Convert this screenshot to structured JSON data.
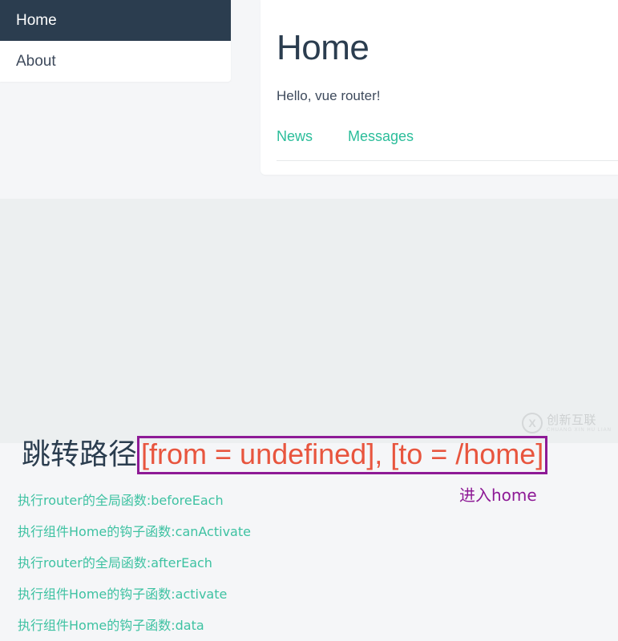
{
  "sidebar": {
    "items": [
      {
        "label": "Home",
        "active": true
      },
      {
        "label": "About",
        "active": false
      }
    ]
  },
  "content": {
    "title": "Home",
    "subtitle": "Hello, vue router!",
    "tabs": [
      {
        "label": "News"
      },
      {
        "label": "Messages"
      }
    ]
  },
  "route_info": {
    "label": "跳转路径",
    "value": "[from = undefined], [to = /home]",
    "value_color": "#e8553e",
    "box_border_color": "#8e1a96"
  },
  "log": {
    "lines": [
      "执行router的全局函数:beforeEach",
      "执行组件Home的钩子函数:canActivate",
      "执行router的全局函数:afterEach",
      "执行组件Home的钩子函数:activate",
      "执行组件Home的钩子函数:data"
    ],
    "color": "#3ec2a2"
  },
  "note": {
    "text": "进入home",
    "color": "#8e1a96"
  },
  "watermark": {
    "cn": "创新互联",
    "en": "CHUANG XIN HU LIAN",
    "mark": "X"
  },
  "theme": {
    "nav_active_bg": "#2b3d4f",
    "accent_teal": "#2bbd9a",
    "page_bg_top": "#f5f6f8",
    "page_bg_bottom": "#eceff0"
  }
}
